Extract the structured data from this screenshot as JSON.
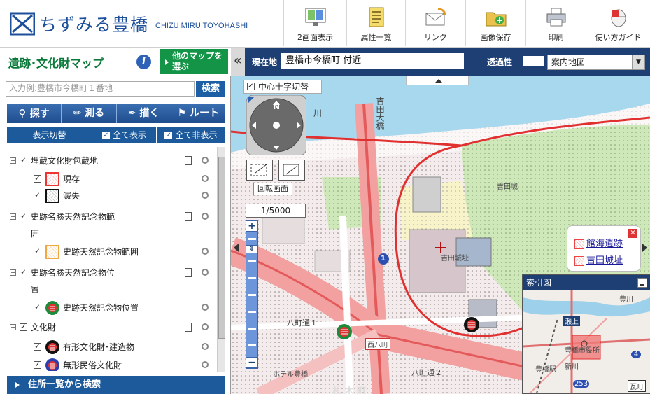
{
  "app": {
    "logo_text": "ちずみる豊橋",
    "logo_sub": "CHIZU MIRU TOYOHASHI"
  },
  "toolbar": [
    {
      "id": "split",
      "label": "2画面表示",
      "icon": "split-screen-icon"
    },
    {
      "id": "attr",
      "label": "属性一覧",
      "icon": "document-list-icon"
    },
    {
      "id": "link",
      "label": "リンク",
      "icon": "envelope-link-icon"
    },
    {
      "id": "save",
      "label": "画像保存",
      "icon": "folder-save-icon"
    },
    {
      "id": "print",
      "label": "印刷",
      "icon": "printer-icon"
    },
    {
      "id": "guide",
      "label": "使い方ガイド",
      "icon": "mouse-icon"
    }
  ],
  "panel": {
    "title": "遺跡･文化財マップ",
    "info_icon": "i",
    "other_maps": "他のマップを選ぶ",
    "search_placeholder": "入力例:豊橋市今橋町１番地",
    "search_button": "検索",
    "tools": [
      "探す",
      "測る",
      "描く",
      "ルート"
    ],
    "toggle": {
      "label": "表示切替",
      "show_all": "全て表示",
      "hide_all": "全て非表示"
    },
    "address_search": "住所一覧から検索"
  },
  "layers": [
    {
      "label": "埋蔵文化財包蔵地",
      "level": 0,
      "checked": true
    },
    {
      "label": "現存",
      "level": 1,
      "checked": true,
      "symbol": "red-square"
    },
    {
      "label": "滅失",
      "level": 1,
      "checked": true,
      "symbol": "black-square"
    },
    {
      "label": "史跡名勝天然記念物範",
      "label2": "囲",
      "level": 0,
      "checked": true
    },
    {
      "label": "史跡天然記念物範囲",
      "level": 1,
      "checked": true,
      "symbol": "orange-square"
    },
    {
      "label": "史跡名勝天然記念物位",
      "label2": "置",
      "level": 0,
      "checked": true
    },
    {
      "label": "史跡天然記念物位置",
      "level": 1,
      "checked": true,
      "symbol": "green-marker"
    },
    {
      "label": "文化財",
      "level": 0,
      "checked": true
    },
    {
      "label": "有形文化財･建造物",
      "level": 1,
      "checked": true,
      "symbol": "black-marker"
    },
    {
      "label": "無形民俗文化財",
      "level": 1,
      "checked": true,
      "symbol": "blue-marker"
    }
  ],
  "map": {
    "location_label": "現在地",
    "location_value": "豊橋市今橋町 付近",
    "opacity_label": "透過性",
    "basemap": "案内地図",
    "crosshair_toggle": "中心十字切替",
    "rotate": "回転画面",
    "scale": "1/5000",
    "labels": {
      "river": "川",
      "yoshida_ohashi": "吉田大橋",
      "yoshida_park": "吉田城址",
      "kitchen_district": "吉田城",
      "hachimachi": "八町通１",
      "hachimachi2": "八町通２",
      "nishihacchou": "西八町",
      "road1": "1",
      "hotel": "ホテル豊橋",
      "mototome": "札 木 町"
    },
    "popup": {
      "items": [
        "館海遺跡",
        "吉田城址"
      ]
    },
    "index_map": {
      "title": "索引図",
      "labels": [
        "豊川",
        "瀬上",
        "豊橋市役所",
        "豊橋駅",
        "新川",
        "瓦町"
      ],
      "route_numbers": [
        "4",
        "253"
      ]
    }
  },
  "colors": {
    "brand_blue": "#1d4f9a",
    "green_title": "#0a7a3a",
    "nav_dark": "#1d3f73",
    "road_red": "#e03030"
  }
}
